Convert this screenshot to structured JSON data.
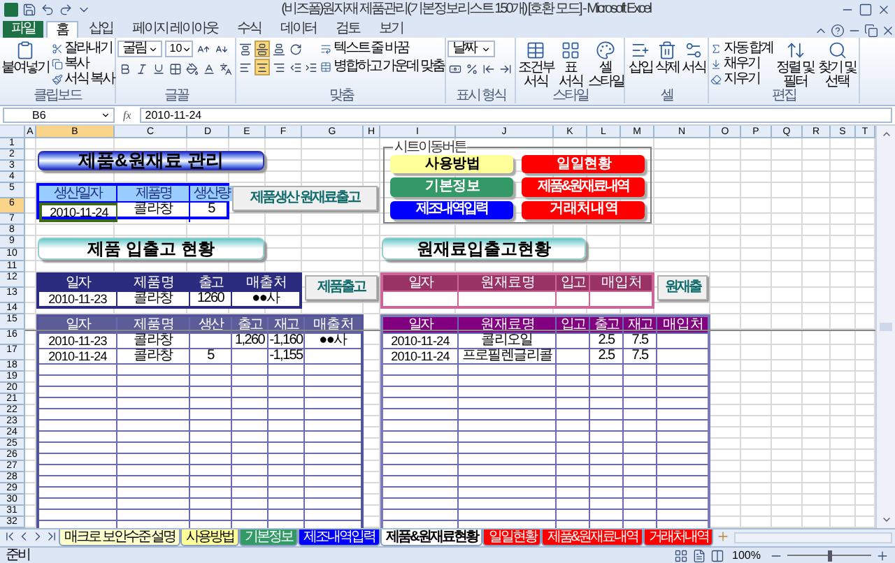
{
  "window": {
    "title": "(비즈폼)원자재 제품관리(기본정보리스트 150개) [호환 모드] - Microsoft Excel"
  },
  "ribbon_tabs": [
    {
      "label": "파일",
      "kind": "file",
      "selected": false
    },
    {
      "label": "홈",
      "kind": "tab",
      "selected": true
    },
    {
      "label": "삽입",
      "kind": "tab",
      "selected": false
    },
    {
      "label": "페이지 레이아웃",
      "kind": "tab",
      "selected": false
    },
    {
      "label": "수식",
      "kind": "tab",
      "selected": false
    },
    {
      "label": "데이터",
      "kind": "tab",
      "selected": false
    },
    {
      "label": "검토",
      "kind": "tab",
      "selected": false
    },
    {
      "label": "보기",
      "kind": "tab",
      "selected": false
    }
  ],
  "ribbon_groups": [
    {
      "kind": "clipboard",
      "label": "클립보드",
      "items": [
        "붙여넣기",
        "잘라내기",
        "복사",
        "서식 복사"
      ]
    },
    {
      "kind": "font",
      "label": "글꼴",
      "font": "굴림",
      "size": "10"
    },
    {
      "kind": "alignment",
      "label": "맞춤",
      "buttons": [
        {
          "selected": false
        },
        {
          "selected": true
        },
        {
          "selected": false
        },
        {
          "selected": false
        },
        {
          "selected": true
        },
        {
          "selected": false
        }
      ],
      "items": [
        "텍스트 줄 바꿈",
        "병합하고 가운데 맞춤"
      ]
    },
    {
      "kind": "number",
      "label": "표시 형식",
      "format": "날짜"
    },
    {
      "kind": "styles",
      "label": "스타일",
      "items": [
        "조건부 서식",
        "표 서식",
        "셀 스타일"
      ]
    },
    {
      "kind": "cells",
      "label": "셀",
      "items": [
        "삽입",
        "삭제",
        "서식"
      ]
    },
    {
      "kind": "editing",
      "label": "편집",
      "items": [
        "자동 합계",
        "채우기",
        "지우기",
        "정렬 및 필터",
        "찾기 및 선택"
      ]
    }
  ],
  "formula_bar": {
    "name_box": "B6",
    "function_label": "fx",
    "value": "2010-11-24"
  },
  "columns": [
    {
      "label": "A",
      "selected": false
    },
    {
      "label": "B",
      "selected": true
    },
    {
      "label": "C",
      "selected": false
    },
    {
      "label": "D",
      "selected": false
    },
    {
      "label": "E",
      "selected": false
    },
    {
      "label": "F",
      "selected": false
    },
    {
      "label": "G",
      "selected": false
    },
    {
      "label": "H",
      "selected": false
    },
    {
      "label": "I",
      "selected": false
    },
    {
      "label": "J",
      "selected": false
    },
    {
      "label": "K",
      "selected": false
    },
    {
      "label": "L",
      "selected": false
    },
    {
      "label": "M",
      "selected": false
    },
    {
      "label": "N",
      "selected": false
    },
    {
      "label": "O",
      "selected": false
    },
    {
      "label": "P",
      "selected": false
    },
    {
      "label": "Q",
      "selected": false
    },
    {
      "label": "R",
      "selected": false
    },
    {
      "label": "S",
      "selected": false
    },
    {
      "label": "T",
      "selected": false
    }
  ],
  "rows": [
    {
      "label": "1",
      "selected": false
    },
    {
      "label": "2",
      "selected": false
    },
    {
      "label": "3",
      "selected": false
    },
    {
      "label": "4",
      "selected": false
    },
    {
      "label": "5",
      "selected": false
    },
    {
      "label": "6",
      "selected": true
    },
    {
      "label": "7",
      "selected": false
    },
    {
      "label": "8",
      "selected": false
    },
    {
      "label": "9",
      "selected": false
    },
    {
      "label": "10",
      "selected": false
    },
    {
      "label": "11",
      "selected": false
    },
    {
      "label": "12",
      "selected": false
    },
    {
      "label": "13",
      "selected": false
    },
    {
      "label": "14",
      "selected": false
    },
    {
      "label": "15",
      "selected": false
    },
    {
      "label": "16",
      "selected": false
    },
    {
      "label": "17",
      "selected": false
    },
    {
      "label": "18",
      "selected": false
    },
    {
      "label": "19",
      "selected": false
    },
    {
      "label": "20",
      "selected": false
    },
    {
      "label": "21",
      "selected": false
    },
    {
      "label": "22",
      "selected": false
    },
    {
      "label": "23",
      "selected": false
    },
    {
      "label": "24",
      "selected": false
    },
    {
      "label": "25",
      "selected": false
    },
    {
      "label": "26",
      "selected": false
    },
    {
      "label": "27",
      "selected": false
    },
    {
      "label": "28",
      "selected": false
    },
    {
      "label": "29",
      "selected": false
    },
    {
      "label": "30",
      "selected": false
    },
    {
      "label": "31",
      "selected": false
    },
    {
      "label": "32",
      "selected": false
    }
  ],
  "title_banner": "제품&원재료 관리",
  "production_form": {
    "columns": [
      "생산일자",
      "제품명",
      "생산량"
    ],
    "rows": [
      [
        "2010-11-24",
        "콜라창",
        "5"
      ]
    ],
    "button": "제품생산 원재료출고"
  },
  "sheet_nav": {
    "label": "시트이동버튼",
    "buttons": [
      {
        "label": "사 용 방 법",
        "color": "#ffff99"
      },
      {
        "label": "일 일 현 황",
        "color": "#ff0000"
      },
      {
        "label": "기 본 정 보",
        "color": "#339966"
      },
      {
        "label": "제품&원재료내역",
        "color": "#ff0000"
      },
      {
        "label": "제조내역입력",
        "color": "#0000ff"
      },
      {
        "label": "거 래 처 내 역",
        "color": "#ff0000"
      }
    ]
  },
  "product_section": {
    "title": "제품 입출고 현황",
    "entry": {
      "columns": [
        "일자",
        "제 품 명",
        "출고",
        "매 출 처"
      ],
      "rows": [
        [
          "2010-11-23",
          "콜라창",
          "1260",
          "●●사"
        ]
      ],
      "button": "제품출고"
    },
    "ledger": {
      "columns": [
        "일자",
        "제 품 명",
        "생산",
        "출고",
        "재고",
        "매 출 처"
      ],
      "rows": [
        [
          "2010-11-23",
          "콜라창",
          null,
          "1,260",
          "-1,160",
          "●●사"
        ],
        [
          "2010-11-24",
          "콜라창",
          "5",
          null,
          "-1,155",
          null
        ]
      ]
    }
  },
  "material_section": {
    "title": "원재료입출고현황",
    "entry": {
      "columns": [
        "일자",
        "원 재 료 명",
        "입고",
        "매 입 처"
      ],
      "button": "원재출"
    },
    "ledger": {
      "columns": [
        "일자",
        "원 재 료 명",
        "입고",
        "출고",
        "재고",
        "매 입 처"
      ],
      "rows": [
        [
          "2010-11-24",
          "콜리오일",
          null,
          "2.5",
          "7.5",
          null
        ],
        [
          "2010-11-24",
          "프로필렌글리콜",
          null,
          "2.5",
          "7.5",
          null
        ]
      ]
    }
  },
  "sheet_tabs": [
    {
      "label": "매크로 보안수준 설명",
      "color": "#ffffcc",
      "selected": false
    },
    {
      "label": "사용방법",
      "color": "#ffff99",
      "selected": false
    },
    {
      "label": "기본정보",
      "color": "#339966",
      "selected": false
    },
    {
      "label": "제조내역입력",
      "color": "#0000ff",
      "selected": false
    },
    {
      "label": "제품&원재료현황",
      "selected": true
    },
    {
      "label": "일일현황",
      "color": "#ff0000",
      "selected": false
    },
    {
      "label": "제품&원재료내역",
      "color": "#ff0000",
      "selected": false
    },
    {
      "label": "거래처내역",
      "color": "#ff0000",
      "selected": false
    }
  ],
  "status_bar": {
    "text": "준비",
    "zoom": "100%",
    "zoom_slider": {
      "level": 0.5
    }
  }
}
